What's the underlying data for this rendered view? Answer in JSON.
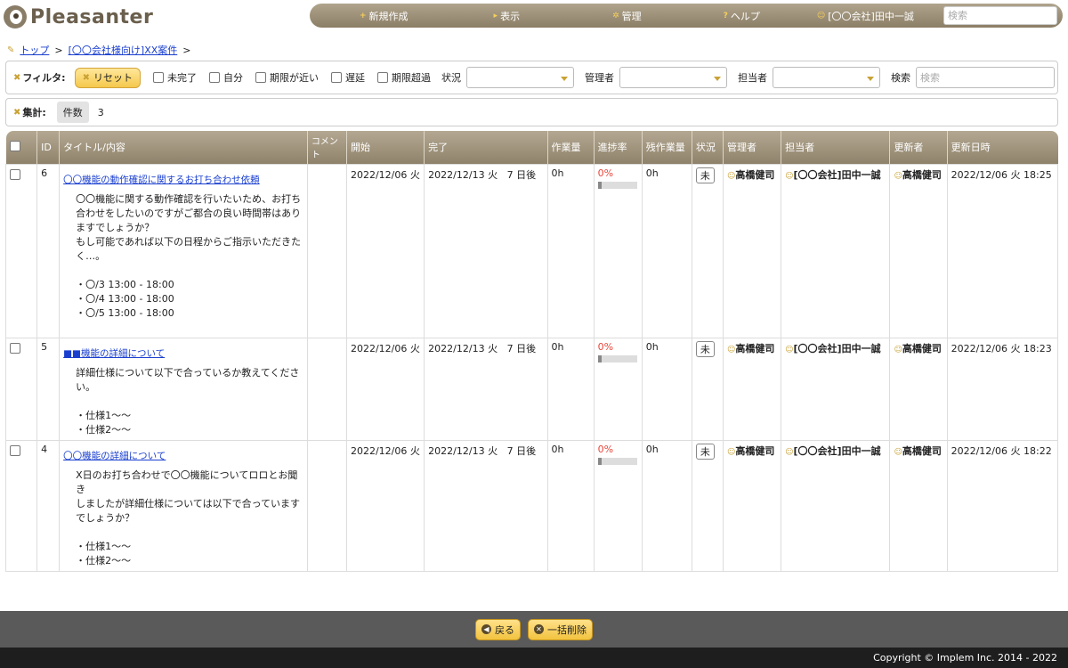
{
  "app": {
    "name": "Pleasanter"
  },
  "nav": {
    "items": [
      {
        "icon": "+",
        "label": "新規作成"
      },
      {
        "icon": "▸",
        "label": "表示"
      },
      {
        "icon": "✲",
        "label": "管理"
      },
      {
        "icon": "?",
        "label": "ヘルプ"
      },
      {
        "icon": "☺",
        "label": "[〇〇会社]田中一誠"
      }
    ],
    "search_placeholder": "検索"
  },
  "breadcrumb": {
    "items": [
      "トップ",
      "[〇〇会社様向け]XX案件"
    ],
    "separator": ">"
  },
  "filter": {
    "label": "フィルタ:",
    "reset": "リセット",
    "checkboxes": [
      "未完了",
      "自分",
      "期限が近い",
      "遅延",
      "期限超過"
    ],
    "status_label": "状況",
    "manager_label": "管理者",
    "owner_label": "担当者",
    "search_label": "検索",
    "search_placeholder": "検索"
  },
  "summary": {
    "label": "集計:",
    "tag": "件数",
    "value": "3"
  },
  "table": {
    "headers": [
      "ID",
      "タイトル/内容",
      "コメント",
      "開始",
      "完了",
      "作業量",
      "進捗率",
      "残作業量",
      "状況",
      "管理者",
      "担当者",
      "更新者",
      "更新日時"
    ],
    "rows": [
      {
        "id": "6",
        "title": "〇〇機能の動作確認に関するお打ち合わせ依頼",
        "content": "〇〇機能に関する動作確認を行いたいため、お打ち\n合わせをしたいのですがご都合の良い時間帯はあり\nますでしょうか？\nもし可能であれば以下の日程からご指示いただきた\nく…。\n\n・〇/3 13:00 - 18:00\n・〇/4 13:00 - 18:00\n・〇/5 13:00 - 18:00",
        "comment": "",
        "start": "2022/12/06 火",
        "end": "2022/12/13 火",
        "end_rel": "7 日後",
        "work": "0h",
        "progress": "0%",
        "remain": "0h",
        "status": "未",
        "manager": "高橋健司",
        "owner": "[〇〇会社]田中一誠",
        "updater": "高橋健司",
        "updated": "2022/12/06 火 18:25"
      },
      {
        "id": "5",
        "title": "■■機能の詳細について",
        "content": "詳細仕様について以下で合っているか教えてくださ\nい。\n\n・仕様1〜〜\n・仕様2〜〜",
        "comment": "",
        "start": "2022/12/06 火",
        "end": "2022/12/13 火",
        "end_rel": "7 日後",
        "work": "0h",
        "progress": "0%",
        "remain": "0h",
        "status": "未",
        "manager": "高橋健司",
        "owner": "[〇〇会社]田中一誠",
        "updater": "高橋健司",
        "updated": "2022/12/06 火 18:23"
      },
      {
        "id": "4",
        "title": "〇〇機能の詳細について",
        "content": "X日のお打ち合わせで〇〇機能についてロロとお聞き\nしましたが詳細仕様については以下で合っています\nでしょうか？\n\n・仕様1〜〜\n・仕様2〜〜",
        "comment": "",
        "start": "2022/12/06 火",
        "end": "2022/12/13 火",
        "end_rel": "7 日後",
        "work": "0h",
        "progress": "0%",
        "remain": "0h",
        "status": "未",
        "manager": "高橋健司",
        "owner": "[〇〇会社]田中一誠",
        "updater": "高橋健司",
        "updated": "2022/12/06 火 18:22"
      }
    ]
  },
  "footer": {
    "back": "戻る",
    "bulk_delete": "一括削除",
    "copyright": "Copyright © Implem Inc. 2014 - 2022"
  }
}
